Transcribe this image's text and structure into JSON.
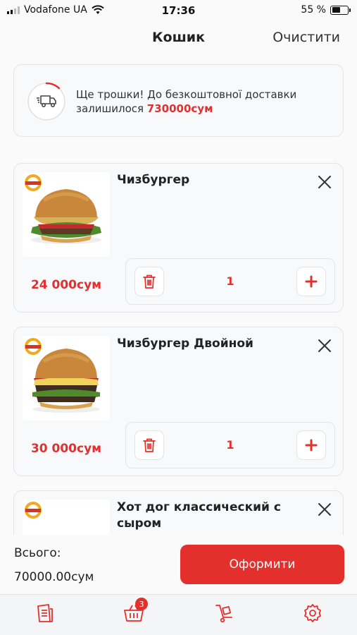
{
  "status_bar": {
    "carrier": "Vodafone UA",
    "time": "17:36",
    "battery": "55 %"
  },
  "header": {
    "title": "Кошик",
    "clear_label": "Очистити"
  },
  "delivery": {
    "text": "Ще трошки! До безкоштовної доставки залишилося",
    "amount": "730000сум",
    "icon": "truck-icon",
    "progress": 0.12
  },
  "cart": {
    "items": [
      {
        "name": "Чизбургер",
        "price": "24 000сум",
        "quantity": "1"
      },
      {
        "name": "Чизбургер Двойной",
        "price": "30 000сум",
        "quantity": "1"
      },
      {
        "name": "Хот дог классический с сыром",
        "price": "",
        "quantity": ""
      }
    ]
  },
  "summary": {
    "total_label": "Всього:",
    "total_value": "70000.00сум",
    "checkout_label": "Оформити"
  },
  "tabbar": {
    "cart_badge": "3",
    "tabs": [
      "menu-icon",
      "basket-icon",
      "delivery-cart-icon",
      "settings-icon"
    ]
  },
  "colors": {
    "accent": "#e3302c",
    "price": "#e22f2f"
  }
}
